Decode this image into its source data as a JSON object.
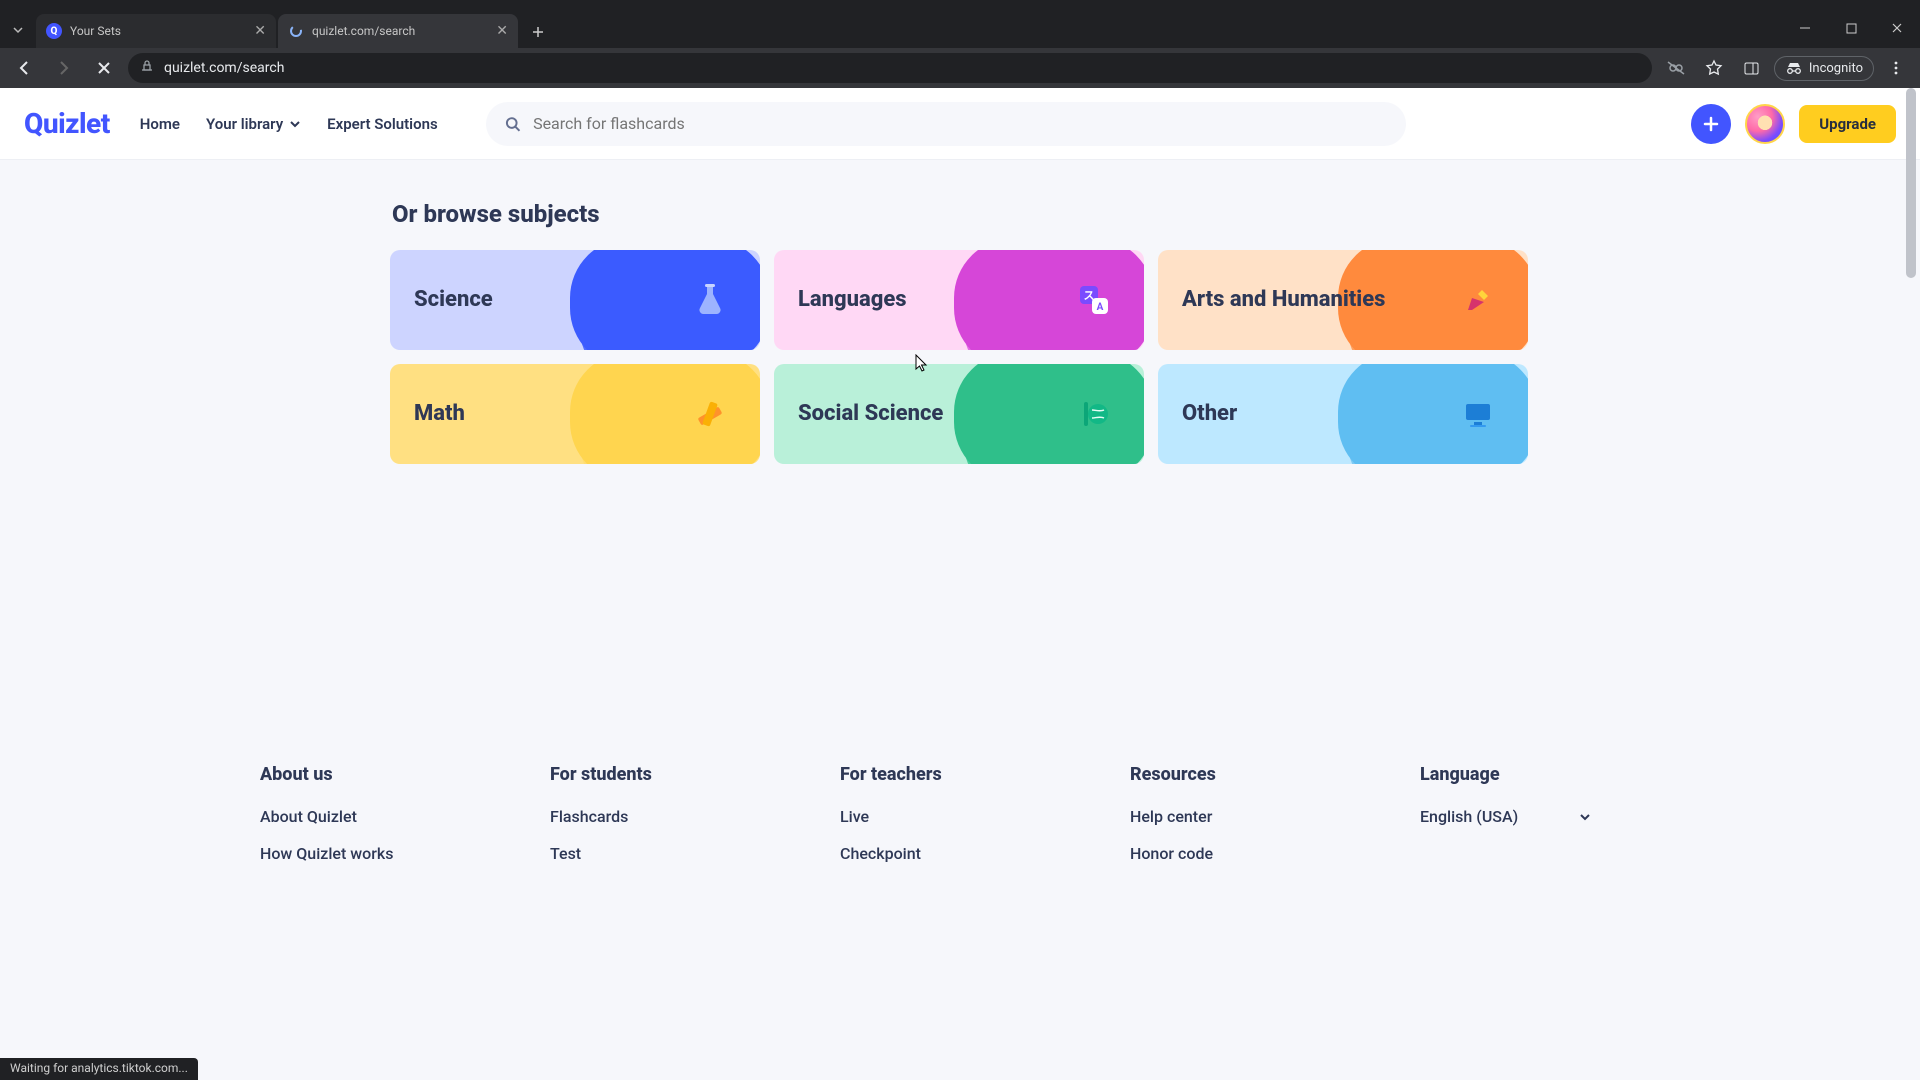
{
  "browser": {
    "tabs": [
      {
        "title": "Your Sets",
        "active": false
      },
      {
        "title": "quizlet.com/search",
        "active": true
      }
    ],
    "url": "quizlet.com/search",
    "incognito_label": "Incognito",
    "status_text": "Waiting for analytics.tiktok.com..."
  },
  "header": {
    "logo": "Quizlet",
    "nav": {
      "home": "Home",
      "library": "Your library",
      "expert": "Expert Solutions"
    },
    "search_placeholder": "Search for flashcards",
    "upgrade": "Upgrade"
  },
  "main": {
    "section_title": "Or browse subjects",
    "subjects": [
      {
        "label": "Science"
      },
      {
        "label": "Languages"
      },
      {
        "label": "Arts and Humanities"
      },
      {
        "label": "Math"
      },
      {
        "label": "Social Science"
      },
      {
        "label": "Other"
      }
    ]
  },
  "footer": {
    "cols": [
      {
        "title": "About us",
        "links": [
          "About Quizlet",
          "How Quizlet works"
        ]
      },
      {
        "title": "For students",
        "links": [
          "Flashcards",
          "Test"
        ]
      },
      {
        "title": "For teachers",
        "links": [
          "Live",
          "Checkpoint"
        ]
      },
      {
        "title": "Resources",
        "links": [
          "Help center",
          "Honor code"
        ]
      }
    ],
    "language_title": "Language",
    "language_value": "English (USA)"
  }
}
